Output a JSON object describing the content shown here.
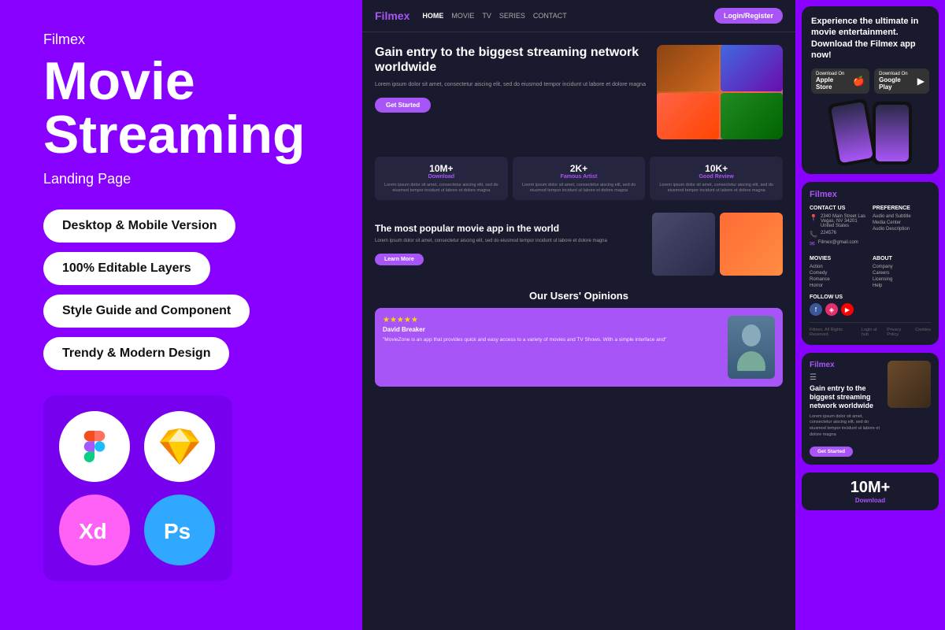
{
  "brand": {
    "name": "Filmex",
    "logo_color": "#a855f7"
  },
  "left": {
    "brand_label": "Filmex",
    "title_line1": "Movie",
    "title_line2": "Streaming",
    "subtitle": "Landing Page",
    "features": [
      "Desktop & Mobile Version",
      "100% Editable Layers",
      "Style Guide and Component",
      "Trendy & Modern Design"
    ],
    "tools": [
      "Figma",
      "Sketch",
      "XD",
      "Photoshop"
    ]
  },
  "filmex_site": {
    "nav": {
      "logo": "Filmex",
      "links": [
        "HOME",
        "MOVIE",
        "TV",
        "SERIES",
        "CONTACT"
      ],
      "cta": "Login/Register"
    },
    "hero": {
      "title": "Gain entry to the biggest streaming network worldwide",
      "description": "Lorem ipsum dolor sit amet, consectetur aiscing elit, sed do eiusmod tempor incidunt ut labore et dolore magna",
      "cta": "Get Started"
    },
    "stats": [
      {
        "number": "10M+",
        "label": "Download",
        "desc": "Lorem ipsum dolor sit amet, consectetur aiscing elit, sed do eiusmod tempor incidunt ut labore et dolore magna"
      },
      {
        "number": "2K+",
        "label": "Famous Artist",
        "desc": "Lorem ipsum dolor sit amet, consectetur aiscing elit, sed do eiusmod tempor incidunt ut labore et dolore magna"
      },
      {
        "number": "10K+",
        "label": "Good Review",
        "desc": "Lorem ipsum dolor sit amet, consectetur aiscing elit, sed do eiusmod tempor incidunt ut labore et dolore magna"
      }
    ],
    "popular": {
      "title": "The most popular movie app in the world",
      "description": "Lorem ipsum dolor sit amet, consectetur aiscing elit, sed do eiusmod tempor incidunt ut labore et dolore magna",
      "cta": "Learn More"
    },
    "opinions": {
      "title": "Our Users' Opinions",
      "review": {
        "stars": "★★★★★",
        "name": "David Breaker",
        "text": "\"MovieZone is an app that provides quick and easy access to a variety of movies and TV Shows. With a simple interface and\""
      }
    }
  },
  "right": {
    "app_card": {
      "title": "Experience the ultimate in movie entertainment. Download the Filmex app now!",
      "apple_store": "Download On",
      "apple_store_name": "Apple Store",
      "google_play": "Download On",
      "google_play_name": "Google Play"
    },
    "footer_card": {
      "logo": "Filmex",
      "contact_us": "CONTACT US",
      "preference": "PREFERENCE",
      "address": "2340 Main Street Las Vegas, NV 34201 United States",
      "phone": "224576",
      "email": "Filmex@gmail.com",
      "pref_items": [
        "Audio and Subtitle",
        "Media Center",
        "Audio Description"
      ],
      "movies": "MOVIES",
      "about": "ABOUT",
      "follow": "FOLLOW US",
      "movie_items": [
        "Action",
        "Comedy",
        "Romance",
        "Horror"
      ],
      "about_items": [
        "Company",
        "Careers",
        "Licensing",
        "Help"
      ],
      "footer_links": [
        "Filmex. All Rights Reserved.",
        "Login at hub",
        "Privacy Policy",
        "Cookies"
      ]
    },
    "mobile_card": {
      "logo": "Filmex",
      "title": "Gain entry to the biggest streaming network worldwide",
      "description": "Lorem ipsum dolor sit amet, consectetur aiscing elit, sed do eiusmod tempor incidunt ut labore et dolore magna",
      "cta": "Get Started"
    },
    "bottom_stat": {
      "number": "10M+",
      "label": "Download"
    }
  }
}
